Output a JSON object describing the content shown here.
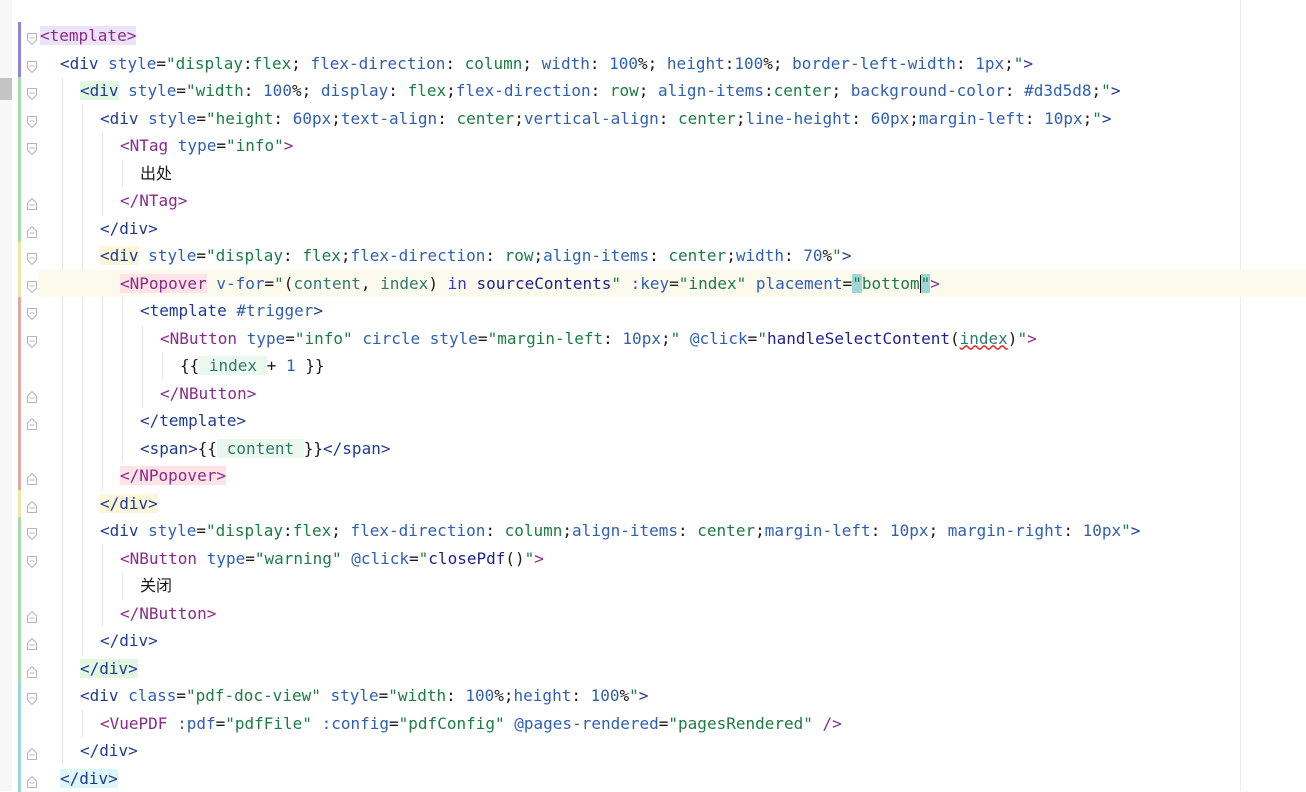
{
  "editor": {
    "language": "vue-template",
    "lines": [
      {
        "id": "l1",
        "fold": "open",
        "guide": "#8c87e6",
        "segments": [
          [
            "tag bg-purple",
            "<template>"
          ]
        ]
      },
      {
        "id": "l2",
        "fold": "open",
        "guide": "#8c87e6",
        "segments": [
          [
            "tag-html",
            "<div "
          ],
          [
            "attr",
            "style"
          ],
          [
            "txt",
            "="
          ],
          [
            "str",
            "\"display"
          ],
          [
            "txt",
            ":"
          ],
          [
            "str",
            "flex"
          ],
          [
            "txt",
            "; "
          ],
          [
            "attr",
            "flex-direction"
          ],
          [
            "txt",
            ": "
          ],
          [
            "str",
            "column"
          ],
          [
            "txt",
            "; "
          ],
          [
            "attr",
            "width"
          ],
          [
            "txt",
            ": "
          ],
          [
            "num",
            "100"
          ],
          [
            "txt",
            "%; "
          ],
          [
            "attr",
            "height"
          ],
          [
            "txt",
            ":"
          ],
          [
            "num",
            "100"
          ],
          [
            "txt",
            "%; "
          ],
          [
            "attr",
            "border-left-width"
          ],
          [
            "txt",
            ": "
          ],
          [
            "num",
            "1px"
          ],
          [
            "txt",
            ";"
          ],
          [
            "str",
            "\""
          ],
          [
            "tag-html",
            ">"
          ]
        ]
      },
      {
        "id": "l3",
        "fold": "open",
        "guide": "#a8dca8",
        "segments": [
          [
            "tag-html bg-green",
            "<div"
          ],
          [
            "txt",
            " "
          ],
          [
            "attr",
            "style"
          ],
          [
            "txt",
            "="
          ],
          [
            "str",
            "\"width"
          ],
          [
            "txt",
            ": "
          ],
          [
            "num",
            "100"
          ],
          [
            "txt",
            "%; "
          ],
          [
            "attr",
            "display"
          ],
          [
            "txt",
            ": "
          ],
          [
            "str",
            "flex"
          ],
          [
            "txt",
            ";"
          ],
          [
            "attr",
            "flex-direction"
          ],
          [
            "txt",
            ": "
          ],
          [
            "str",
            "row"
          ],
          [
            "txt",
            "; "
          ],
          [
            "attr",
            "align-items"
          ],
          [
            "txt",
            ":"
          ],
          [
            "str",
            "center"
          ],
          [
            "txt",
            "; "
          ],
          [
            "attr",
            "background-color"
          ],
          [
            "txt",
            ": "
          ],
          [
            "num",
            "#d3d5d8"
          ],
          [
            "txt",
            ";"
          ],
          [
            "str",
            "\""
          ],
          [
            "tag-html",
            ">"
          ]
        ]
      },
      {
        "id": "l4",
        "fold": "open",
        "guide": "#a8dca8",
        "segments": [
          [
            "tag-html",
            "<div "
          ],
          [
            "attr",
            "style"
          ],
          [
            "txt",
            "="
          ],
          [
            "str",
            "\"height"
          ],
          [
            "txt",
            ": "
          ],
          [
            "num",
            "60px"
          ],
          [
            "txt",
            ";"
          ],
          [
            "attr",
            "text-align"
          ],
          [
            "txt",
            ": "
          ],
          [
            "str",
            "center"
          ],
          [
            "txt",
            ";"
          ],
          [
            "attr",
            "vertical-align"
          ],
          [
            "txt",
            ": "
          ],
          [
            "str",
            "center"
          ],
          [
            "txt",
            ";"
          ],
          [
            "attr",
            "line-height"
          ],
          [
            "txt",
            ": "
          ],
          [
            "num",
            "60px"
          ],
          [
            "txt",
            ";"
          ],
          [
            "attr",
            "margin-left"
          ],
          [
            "txt",
            ": "
          ],
          [
            "num",
            "10px"
          ],
          [
            "txt",
            ";"
          ],
          [
            "str",
            "\""
          ],
          [
            "tag-html",
            ">"
          ]
        ]
      },
      {
        "id": "l5",
        "fold": "open",
        "guide": "#a8dca8",
        "segments": [
          [
            "tagc",
            "<NTag "
          ],
          [
            "attr",
            "type"
          ],
          [
            "txt",
            "="
          ],
          [
            "str",
            "\"info\""
          ],
          [
            "tagc",
            ">"
          ]
        ]
      },
      {
        "id": "l6",
        "fold": "none",
        "guide": "#a8dca8",
        "segments": [
          [
            "txt chinese",
            "出处"
          ]
        ]
      },
      {
        "id": "l7",
        "fold": "close",
        "guide": "#a8dca8",
        "segments": [
          [
            "tagc",
            "</NTag>"
          ]
        ]
      },
      {
        "id": "l8",
        "fold": "close",
        "guide": "#a8dca8",
        "segments": [
          [
            "tag-html",
            "</div>"
          ]
        ]
      },
      {
        "id": "l9",
        "fold": "open",
        "guide": "#f0e6a8",
        "segments": [
          [
            "tag-html bg-yellow",
            "<div"
          ],
          [
            "txt",
            " "
          ],
          [
            "attr",
            "style"
          ],
          [
            "txt",
            "="
          ],
          [
            "str",
            "\"display"
          ],
          [
            "txt",
            ": "
          ],
          [
            "str",
            "flex"
          ],
          [
            "txt",
            ";"
          ],
          [
            "attr",
            "flex-direction"
          ],
          [
            "txt",
            ": "
          ],
          [
            "str",
            "row"
          ],
          [
            "txt",
            ";"
          ],
          [
            "attr",
            "align-items"
          ],
          [
            "txt",
            ": "
          ],
          [
            "str",
            "center"
          ],
          [
            "txt",
            ";"
          ],
          [
            "attr",
            "width"
          ],
          [
            "txt",
            ": "
          ],
          [
            "num",
            "70"
          ],
          [
            "txt",
            "%"
          ],
          [
            "str",
            "\""
          ],
          [
            "tag-html",
            ">"
          ]
        ]
      },
      {
        "id": "l10",
        "fold": "open",
        "guide": "#f0e6a8",
        "segments": [
          [
            "tagc bg-pink",
            "<NPopover"
          ],
          [
            "txt",
            " "
          ],
          [
            "attr",
            "v-for"
          ],
          [
            "txt",
            "="
          ],
          [
            "str",
            "\""
          ],
          [
            "txt",
            "("
          ],
          [
            "ident",
            "content"
          ],
          [
            "txt",
            ", "
          ],
          [
            "ident",
            "index"
          ],
          [
            "txt",
            ") "
          ],
          [
            "kw",
            "in"
          ],
          [
            "txt",
            " "
          ],
          [
            "fn",
            "sourceContents"
          ],
          [
            "str",
            "\""
          ],
          [
            "txt",
            " "
          ],
          [
            "attr",
            ":key"
          ],
          [
            "txt",
            "="
          ],
          [
            "str",
            "\"index\""
          ],
          [
            "txt",
            " "
          ],
          [
            "attr",
            "placement"
          ],
          [
            "txt",
            "="
          ],
          [
            "str bg-match",
            "\""
          ],
          [
            "str",
            "bottom"
          ],
          [
            "caret",
            ""
          ],
          [
            "str bg-match",
            "\""
          ],
          [
            "tagc",
            ">"
          ]
        ]
      },
      {
        "id": "l11",
        "fold": "open",
        "guide": "#e0a8a0",
        "segments": [
          [
            "tag-html",
            "<template "
          ],
          [
            "attr",
            "#trigger"
          ],
          [
            "tag-html",
            ">"
          ]
        ]
      },
      {
        "id": "l12",
        "fold": "open",
        "guide": "#e0a8a0",
        "segments": [
          [
            "tagc",
            "<NButton "
          ],
          [
            "attr",
            "type"
          ],
          [
            "txt",
            "="
          ],
          [
            "str",
            "\"info\""
          ],
          [
            "txt",
            " "
          ],
          [
            "attr",
            "circle"
          ],
          [
            "txt",
            " "
          ],
          [
            "attr",
            "style"
          ],
          [
            "txt",
            "="
          ],
          [
            "str",
            "\"margin-left"
          ],
          [
            "txt",
            ": "
          ],
          [
            "num",
            "10px"
          ],
          [
            "txt",
            ";"
          ],
          [
            "str",
            "\""
          ],
          [
            "txt",
            " "
          ],
          [
            "attr",
            "@click"
          ],
          [
            "txt",
            "="
          ],
          [
            "str",
            "\""
          ],
          [
            "fn",
            "handleSelectContent"
          ],
          [
            "txt",
            "("
          ],
          [
            "ident err",
            "index"
          ],
          [
            "txt",
            ")"
          ],
          [
            "str",
            "\""
          ],
          [
            "tagc",
            ">"
          ]
        ]
      },
      {
        "id": "l13",
        "fold": "none",
        "guide": "#e0a8a0",
        "segments": [
          [
            "txt",
            "{{"
          ],
          [
            "ident bg-green2",
            " index "
          ],
          [
            "txt",
            "+ "
          ],
          [
            "num",
            "1"
          ],
          [
            "txt",
            " }}"
          ]
        ]
      },
      {
        "id": "l14",
        "fold": "close",
        "guide": "#e0a8a0",
        "segments": [
          [
            "tagc",
            "</NButton>"
          ]
        ]
      },
      {
        "id": "l15",
        "fold": "close",
        "guide": "#e0a8a0",
        "segments": [
          [
            "tag-html",
            "</template>"
          ]
        ]
      },
      {
        "id": "l16",
        "fold": "none",
        "guide": "#e0a8a0",
        "segments": [
          [
            "tag-html",
            "<span>"
          ],
          [
            "txt",
            "{{"
          ],
          [
            "ident bg-green2",
            " content "
          ],
          [
            "txt",
            "}}"
          ],
          [
            "tag-html",
            "</span>"
          ]
        ]
      },
      {
        "id": "l17",
        "fold": "close",
        "guide": "#e0a8a0",
        "segments": [
          [
            "tagc bg-pink",
            "</NPopover>"
          ]
        ]
      },
      {
        "id": "l18",
        "fold": "close",
        "guide": "#f0e6a8",
        "segments": [
          [
            "tag-html bg-yellow",
            "</div>"
          ]
        ]
      },
      {
        "id": "l19",
        "fold": "open",
        "guide": "#a8dca8",
        "segments": [
          [
            "tag-html",
            "<div "
          ],
          [
            "attr",
            "style"
          ],
          [
            "txt",
            "="
          ],
          [
            "str",
            "\"display"
          ],
          [
            "txt",
            ":"
          ],
          [
            "str",
            "flex"
          ],
          [
            "txt",
            "; "
          ],
          [
            "attr",
            "flex-direction"
          ],
          [
            "txt",
            ": "
          ],
          [
            "str",
            "column"
          ],
          [
            "txt",
            ";"
          ],
          [
            "attr",
            "align-items"
          ],
          [
            "txt",
            ": "
          ],
          [
            "str",
            "center"
          ],
          [
            "txt",
            ";"
          ],
          [
            "attr",
            "margin-left"
          ],
          [
            "txt",
            ": "
          ],
          [
            "num",
            "10px"
          ],
          [
            "txt",
            "; "
          ],
          [
            "attr",
            "margin-right"
          ],
          [
            "txt",
            ": "
          ],
          [
            "num",
            "10px"
          ],
          [
            "str",
            "\""
          ],
          [
            "tag-html",
            ">"
          ]
        ]
      },
      {
        "id": "l20",
        "fold": "open",
        "guide": "#a8dca8",
        "segments": [
          [
            "tagc",
            "<NButton "
          ],
          [
            "attr",
            "type"
          ],
          [
            "txt",
            "="
          ],
          [
            "str",
            "\"warning\""
          ],
          [
            "txt",
            " "
          ],
          [
            "attr",
            "@click"
          ],
          [
            "txt",
            "="
          ],
          [
            "str",
            "\""
          ],
          [
            "fn",
            "closePdf"
          ],
          [
            "txt",
            "()"
          ],
          [
            "str",
            "\""
          ],
          [
            "tagc",
            ">"
          ]
        ]
      },
      {
        "id": "l21",
        "fold": "none",
        "guide": "#a8dca8",
        "segments": [
          [
            "txt chinese",
            "关闭"
          ]
        ]
      },
      {
        "id": "l22",
        "fold": "close",
        "guide": "#a8dca8",
        "segments": [
          [
            "tagc",
            "</NButton>"
          ]
        ]
      },
      {
        "id": "l23",
        "fold": "close",
        "guide": "#a8dca8",
        "segments": [
          [
            "tag-html",
            "</div>"
          ]
        ]
      },
      {
        "id": "l24",
        "fold": "close",
        "guide": "#a8dca8",
        "segments": [
          [
            "tag-html bg-green",
            "</div>"
          ]
        ]
      },
      {
        "id": "l25",
        "fold": "open",
        "guide": "#9bd3e6",
        "segments": [
          [
            "tag-html",
            "<div "
          ],
          [
            "attr",
            "class"
          ],
          [
            "txt",
            "="
          ],
          [
            "str",
            "\"pdf-doc-view\""
          ],
          [
            "txt",
            " "
          ],
          [
            "attr",
            "style"
          ],
          [
            "txt",
            "="
          ],
          [
            "str",
            "\"width"
          ],
          [
            "txt",
            ": "
          ],
          [
            "num",
            "100"
          ],
          [
            "txt",
            "%;"
          ],
          [
            "attr",
            "height"
          ],
          [
            "txt",
            ": "
          ],
          [
            "num",
            "100"
          ],
          [
            "txt",
            "%"
          ],
          [
            "str",
            "\""
          ],
          [
            "tag-html",
            ">"
          ]
        ]
      },
      {
        "id": "l26",
        "fold": "none",
        "guide": "#9bd3e6",
        "segments": [
          [
            "tagc",
            "<VuePDF "
          ],
          [
            "attr",
            ":pdf"
          ],
          [
            "txt",
            "="
          ],
          [
            "str",
            "\"pdfFile\""
          ],
          [
            "txt",
            " "
          ],
          [
            "attr",
            ":config"
          ],
          [
            "txt",
            "="
          ],
          [
            "str",
            "\"pdfConfig\""
          ],
          [
            "txt",
            " "
          ],
          [
            "attr",
            "@pages-rendered"
          ],
          [
            "txt",
            "="
          ],
          [
            "str",
            "\"pagesRendered\""
          ],
          [
            "txt",
            " "
          ],
          [
            "tagc",
            "/>"
          ]
        ]
      },
      {
        "id": "l27",
        "fold": "close",
        "guide": "#9bd3e6",
        "segments": [
          [
            "tag-html",
            "</div>"
          ]
        ]
      },
      {
        "id": "l28",
        "fold": "close",
        "guide": "#9bd3e6",
        "segments": [
          [
            "tag-html bg-cyan",
            "</div>"
          ]
        ]
      }
    ]
  }
}
